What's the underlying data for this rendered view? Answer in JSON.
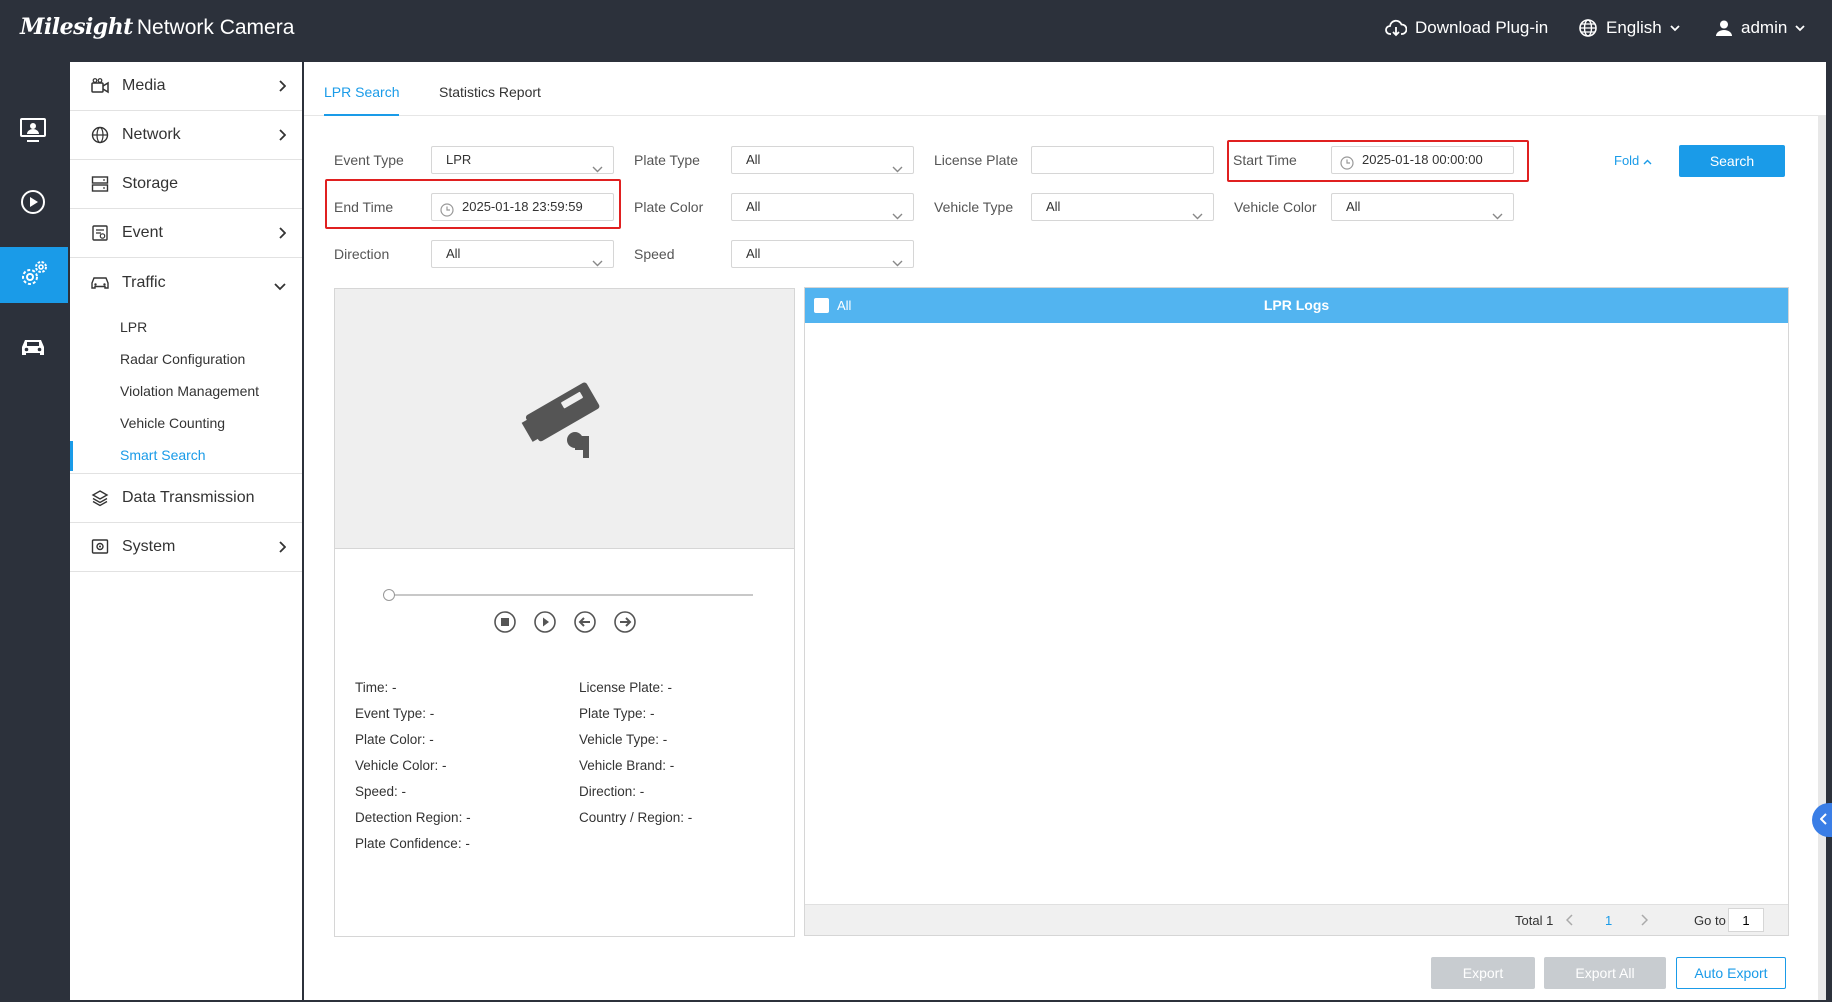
{
  "app": {
    "brand": "Milesight",
    "product": "Network Camera"
  },
  "topbar": {
    "download": "Download Plug-in",
    "language": "English",
    "user": "admin"
  },
  "rail": {
    "items": [
      "live-view-icon",
      "playback-icon",
      "settings-icon",
      "vehicle-icon"
    ],
    "active": "settings-icon"
  },
  "sidebar": {
    "items": [
      {
        "label": "Media",
        "icon": "media-icon"
      },
      {
        "label": "Network",
        "icon": "network-globe-icon"
      },
      {
        "label": "Storage",
        "icon": "storage-icon"
      },
      {
        "label": "Event",
        "icon": "event-icon"
      },
      {
        "label": "Traffic",
        "icon": "car-icon",
        "expanded": true
      },
      {
        "label": "Data Transmission",
        "icon": "layers-icon"
      },
      {
        "label": "System",
        "icon": "system-icon"
      }
    ],
    "traffic_sub": [
      "LPR",
      "Radar Configuration",
      "Violation Management",
      "Vehicle Counting",
      "Smart Search"
    ],
    "active_sub": "Smart Search"
  },
  "tabs": [
    "LPR Search",
    "Statistics Report"
  ],
  "active_tab": "LPR Search",
  "filters": {
    "event_type": {
      "label": "Event Type",
      "value": "LPR"
    },
    "plate_type": {
      "label": "Plate Type",
      "value": "All"
    },
    "license_plate": {
      "label": "License Plate",
      "value": ""
    },
    "start_time": {
      "label": "Start Time",
      "value": "2025-01-18 00:00:00"
    },
    "end_time": {
      "label": "End Time",
      "value": "2025-01-18 23:59:59"
    },
    "plate_color": {
      "label": "Plate Color",
      "value": "All"
    },
    "vehicle_type": {
      "label": "Vehicle Type",
      "value": "All"
    },
    "vehicle_color": {
      "label": "Vehicle Color",
      "value": "All"
    },
    "direction": {
      "label": "Direction",
      "value": "All"
    },
    "speed": {
      "label": "Speed",
      "value": "All"
    },
    "fold": "Fold",
    "search": "Search"
  },
  "details": {
    "left": [
      "Time: -",
      "Event Type: -",
      "Plate Color: -",
      "Vehicle Color: -",
      "Speed: -",
      "Detection Region: -",
      "Plate Confidence: -"
    ],
    "right": [
      "License Plate: -",
      "Plate Type: -",
      "Vehicle Type: -",
      "Vehicle Brand: -",
      "Direction: -",
      "Country / Region: -"
    ]
  },
  "logs": {
    "select_all": "All",
    "title": "LPR Logs",
    "total": "Total 1",
    "current_page": "1",
    "goto_label": "Go to",
    "goto_value": "1"
  },
  "actions": {
    "export": "Export",
    "export_all": "Export All",
    "auto_export": "Auto Export"
  },
  "colors": {
    "accent": "#1a9be8",
    "header_bg": "#2c313b",
    "logs_header": "#52b4f0",
    "highlight": "#e02020"
  }
}
